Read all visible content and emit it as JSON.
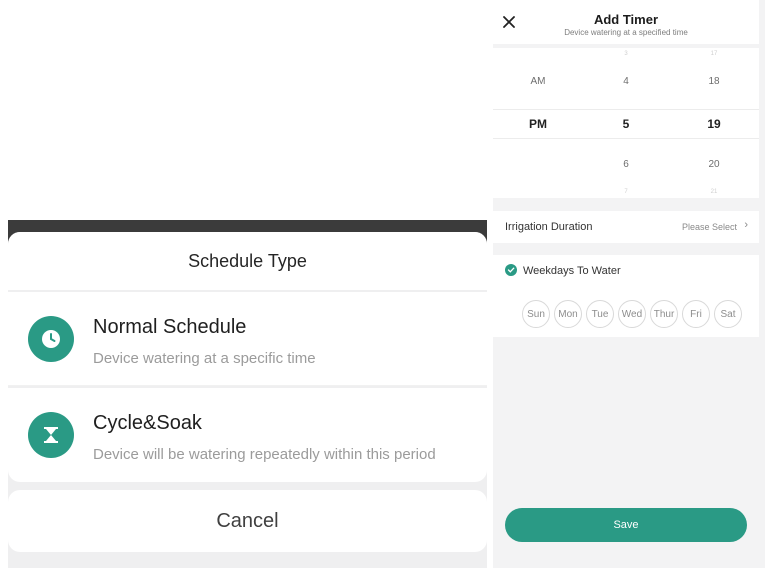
{
  "schedule_sheet": {
    "title": "Schedule Type",
    "options": [
      {
        "title": "Normal Schedule",
        "description": "Device watering  at a specific time",
        "icon": "clock-icon"
      },
      {
        "title": "Cycle&Soak",
        "description": "Device will be watering repeatedly within this period",
        "icon": "hourglass-icon"
      }
    ],
    "cancel_label": "Cancel"
  },
  "add_timer": {
    "title": "Add Timer",
    "subtitle": "Device watering at a specified time",
    "close_icon": "close-icon",
    "picker": {
      "ampm": {
        "items": [
          "AM",
          "PM"
        ],
        "selected": "PM"
      },
      "hour": {
        "items": [
          "3",
          "4",
          "5",
          "6",
          "7"
        ],
        "selected": "5"
      },
      "minute": {
        "items": [
          "17",
          "18",
          "19",
          "20",
          "21"
        ],
        "selected": "19"
      }
    },
    "duration": {
      "label": "Irrigation Duration",
      "value": "Please Select",
      "chevron": "›"
    },
    "weekdays": {
      "label": "Weekdays To Water",
      "days": [
        "Sun",
        "Mon",
        "Tue",
        "Wed",
        "Thur",
        "Fri",
        "Sat"
      ]
    },
    "save_label": "Save"
  },
  "colors": {
    "accent": "#2a9a85",
    "dim_overlay": "#3b3b3b",
    "sheet_bg": "#efeff0"
  }
}
